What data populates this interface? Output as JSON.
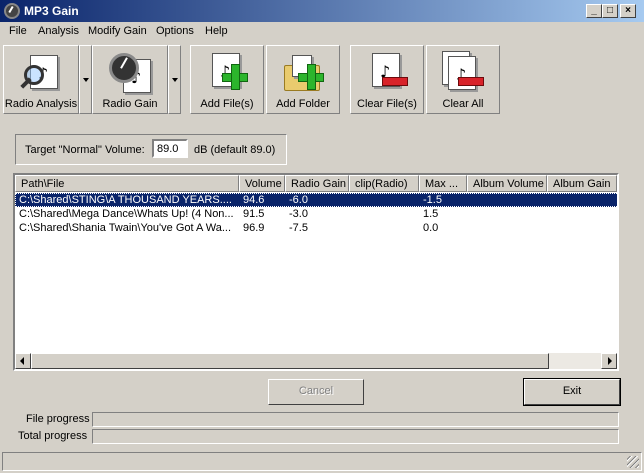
{
  "window": {
    "title": "MP3 Gain"
  },
  "menu": [
    "File",
    "Analysis",
    "Modify Gain",
    "Options",
    "Help"
  ],
  "toolbar": {
    "radio_analysis": "Radio Analysis",
    "radio_gain": "Radio Gain",
    "add_files": "Add File(s)",
    "add_folder": "Add Folder",
    "clear_files": "Clear File(s)",
    "clear_all": "Clear All"
  },
  "target": {
    "label": "Target \"Normal\" Volume:",
    "value": "89.0",
    "unit": "dB  (default 89.0)"
  },
  "list": {
    "columns": [
      "Path\\File",
      "Volume",
      "Radio Gain",
      "clip(Radio)",
      "Max ...",
      "Album Volume",
      "Album Gain"
    ],
    "rows": [
      {
        "path": "C:\\Shared\\STING\\A THOUSAND YEARS....",
        "volume": "94.6",
        "radio_gain": "-6.0",
        "clip": "",
        "max": "-1.5",
        "album_volume": "",
        "album_gain": ""
      },
      {
        "path": "C:\\Shared\\Mega Dance\\Whats Up! (4 Non...",
        "volume": "91.5",
        "radio_gain": "-3.0",
        "clip": "",
        "max": "1.5",
        "album_volume": "",
        "album_gain": ""
      },
      {
        "path": "C:\\Shared\\Shania Twain\\You've Got A Wa...",
        "volume": "96.9",
        "radio_gain": "-7.5",
        "clip": "",
        "max": "0.0",
        "album_volume": "",
        "album_gain": ""
      }
    ],
    "selected_row": 0
  },
  "buttons": {
    "cancel": "Cancel",
    "exit": "Exit"
  },
  "progress": {
    "file_label": "File progress",
    "total_label": "Total progress",
    "file_value": 0,
    "total_value": 0
  },
  "colors": {
    "face": "#d4d0c8",
    "selection": "#0a246a",
    "title_start": "#0a246a",
    "title_end": "#a6caf0"
  }
}
